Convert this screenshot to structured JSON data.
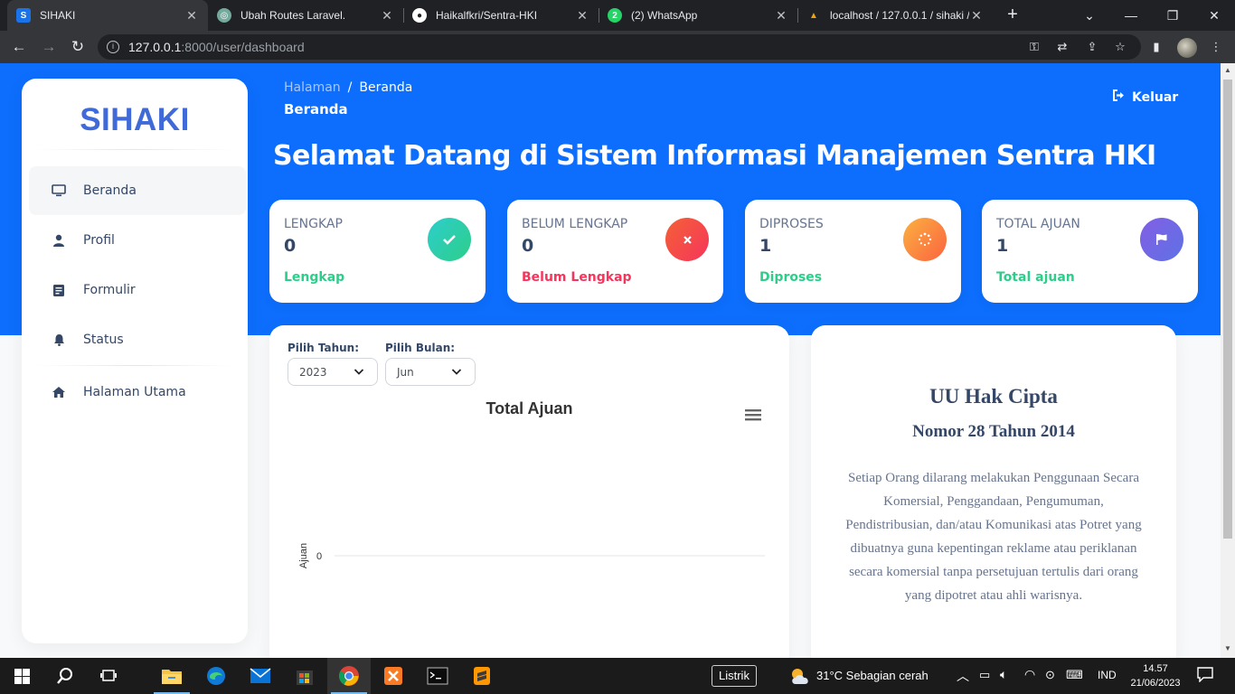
{
  "browser": {
    "tabs": [
      {
        "title": "SIHAKI",
        "icon": "sihaki-favicon",
        "active": true
      },
      {
        "title": "Ubah Routes Laravel.",
        "icon": "chatgpt-favicon",
        "active": false
      },
      {
        "title": "Haikalfkri/Sentra-HKI",
        "icon": "github-favicon",
        "active": false
      },
      {
        "title": "(2) WhatsApp",
        "icon": "whatsapp-favicon",
        "active": false
      },
      {
        "title": "localhost / 127.0.0.1 / sihaki / ...",
        "icon": "phpmyadmin-favicon",
        "active": false
      }
    ],
    "url_host": "127.0.0.1",
    "url_path": ":8000/user/dashboard"
  },
  "sidebar": {
    "brand": "SIHAKI",
    "items": [
      {
        "label": "Beranda",
        "icon": "desktop-icon",
        "active": true
      },
      {
        "label": "Profil",
        "icon": "user-icon",
        "active": false
      },
      {
        "label": "Formulir",
        "icon": "form-icon",
        "active": false
      },
      {
        "label": "Status",
        "icon": "bell-icon",
        "active": false
      },
      {
        "label": "Halaman Utama",
        "icon": "home-icon",
        "active": false
      }
    ]
  },
  "header": {
    "breadcrumb_root": "Halaman",
    "breadcrumb_current": "Beranda",
    "page_title": "Beranda",
    "logout_label": "Keluar",
    "welcome": "Selamat Datang di Sistem Informasi Manajemen Sentra HKI"
  },
  "stats": [
    {
      "label": "LENGKAP",
      "value": "0",
      "footer": "Lengkap",
      "footer_color": "#2dce89",
      "icon": "check-icon",
      "gradient": [
        "#2dce89",
        "#2dcecc"
      ]
    },
    {
      "label": "BELUM LENGKAP",
      "value": "0",
      "footer": "Belum Lengkap",
      "footer_color": "#f5365c",
      "icon": "times-icon",
      "gradient": [
        "#f5365c",
        "#f56036"
      ]
    },
    {
      "label": "DIPROSES",
      "value": "1",
      "footer": "Diproses",
      "footer_color": "#2dce89",
      "icon": "spinner-icon",
      "gradient": [
        "#fb6340",
        "#fbb140"
      ]
    },
    {
      "label": "TOTAL AJUAN",
      "value": "1",
      "footer": "Total ajuan",
      "footer_color": "#2dce89",
      "icon": "flag-icon",
      "gradient": [
        "#5e72e4",
        "#825ee4"
      ]
    }
  ],
  "filters": {
    "year_label": "Pilih Tahun:",
    "year_value": "2023",
    "month_label": "Pilih Bulan:",
    "month_value": "Jun"
  },
  "chart_data": {
    "type": "bar",
    "title": "Total Ajuan",
    "xlabel": "",
    "ylabel": "Ajuan",
    "categories": [],
    "series": [],
    "yticks": [
      "0"
    ],
    "grid": true
  },
  "law": {
    "title": "UU Hak Cipta",
    "subtitle": "Nomor 28 Tahun 2014",
    "body": "Setiap Orang dilarang melakukan Penggunaan Secara Komersial, Penggandaan, Pengumuman, Pendistribusian, dan/atau Komunikasi atas Potret yang dibuatnya guna kepentingan reklame atau periklanan secara komersial tanpa persetujuan tertulis dari orang yang dipotret atau ahli warisnya."
  },
  "taskbar": {
    "listrik": "Listrik",
    "weather": "31°C  Sebagian cerah",
    "lang": "IND",
    "time": "14.57",
    "date": "21/06/2023"
  }
}
